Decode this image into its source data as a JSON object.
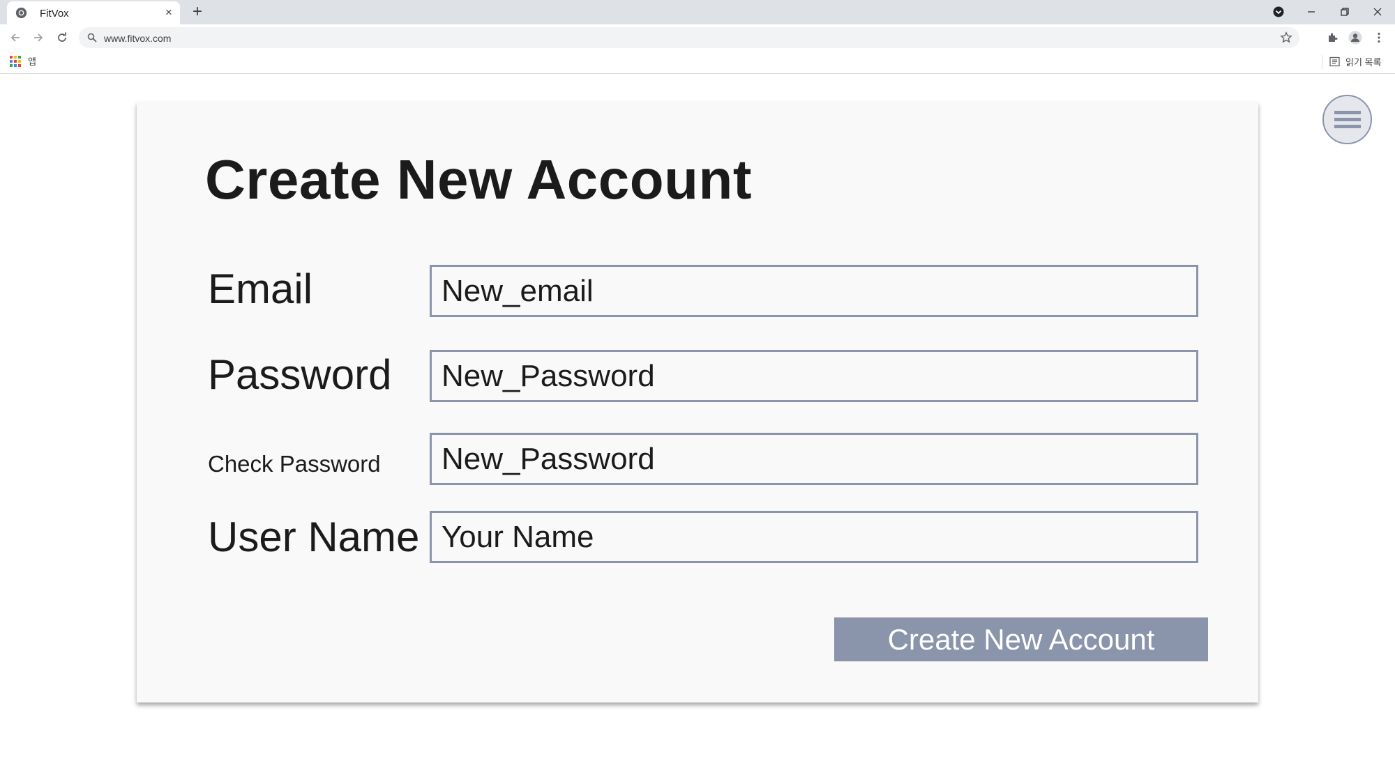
{
  "browser": {
    "tab_title": "FitVox",
    "tab_close": "×",
    "new_tab": "+",
    "url": "www.fitvox.com",
    "bookmark_apps_label": "앱",
    "reading_list_label": "읽기 목록"
  },
  "page": {
    "heading": "Create New Account",
    "fields": [
      {
        "label": "Email",
        "value": "New_email"
      },
      {
        "label": "Password",
        "value": "New_Password"
      },
      {
        "label": "Check Password",
        "value": "New_Password"
      },
      {
        "label": "User Name",
        "value": "Your Name"
      }
    ],
    "submit_label": "Create New Account"
  },
  "colors": {
    "accent": "#8a94ab",
    "card_background": "#f9f9f9",
    "text": "#1b1b1b"
  },
  "icons": [
    "chrome-icon",
    "close-icon",
    "plus-icon",
    "profile-download-icon",
    "minimize-icon",
    "restore-icon",
    "window-close-icon",
    "back-icon",
    "forward-icon",
    "reload-icon",
    "search-icon",
    "star-icon",
    "extensions-icon",
    "profile-icon",
    "kebab-menu-icon",
    "apps-grid-icon",
    "reading-list-icon",
    "hamburger-menu-icon"
  ]
}
